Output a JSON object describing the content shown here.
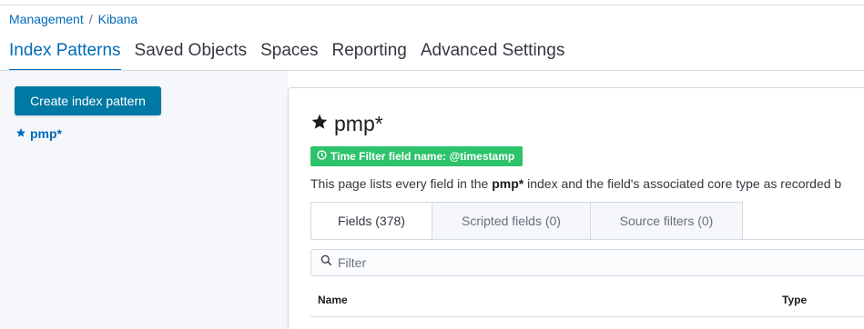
{
  "breadcrumb": {
    "items": [
      "Management",
      "Kibana"
    ],
    "separator": "/"
  },
  "nav": {
    "tabs": [
      {
        "label": "Index Patterns",
        "active": true
      },
      {
        "label": "Saved Objects"
      },
      {
        "label": "Spaces"
      },
      {
        "label": "Reporting"
      },
      {
        "label": "Advanced Settings"
      }
    ]
  },
  "sidebar": {
    "create_button": "Create index pattern",
    "patterns": [
      {
        "name": "pmp*",
        "icon": "star-icon",
        "default": true
      }
    ]
  },
  "pattern": {
    "title": "pmp*",
    "icon": "star-icon",
    "badge": "Time Filter field name: @timestamp",
    "badge_color": "#2dc36b",
    "desc_prefix": "This page lists every field in the ",
    "desc_bold": "pmp*",
    "desc_suffix": " index and the field's associated core type as recorded b"
  },
  "subtabs": [
    {
      "label": "Fields (378)",
      "active": true
    },
    {
      "label": "Scripted fields (0)"
    },
    {
      "label": "Source filters (0)"
    }
  ],
  "filter": {
    "placeholder": "Filter",
    "value": ""
  },
  "table": {
    "columns": [
      "Name",
      "Type"
    ]
  },
  "colors": {
    "accent": "#006bb8",
    "button": "#0079a5"
  }
}
